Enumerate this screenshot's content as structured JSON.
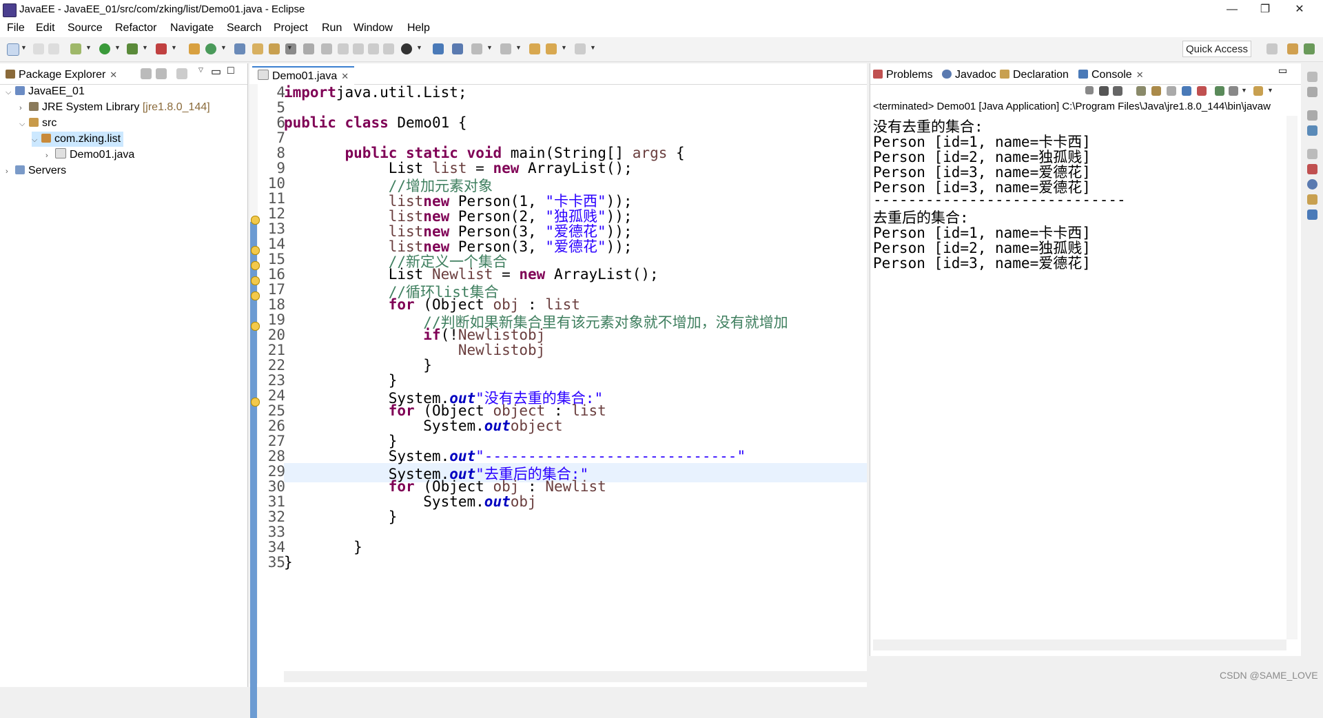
{
  "window": {
    "title": "JavaEE - JavaEE_01/src/com/zking/list/Demo01.java - Eclipse"
  },
  "menubar": [
    "File",
    "Edit",
    "Source",
    "Refactor",
    "Navigate",
    "Search",
    "Project",
    "Run",
    "Window",
    "Help"
  ],
  "toolbar": {
    "quick_access": "Quick Access"
  },
  "package_explorer": {
    "tab_label": "Package Explorer",
    "tree": [
      {
        "label": "JavaEE_01",
        "icon": "project-icon",
        "expanded": true
      },
      {
        "label": "JRE System Library",
        "suffix": "[jre1.8.0_144]",
        "icon": "library-icon"
      },
      {
        "label": "src",
        "icon": "source-folder-icon",
        "expanded": true
      },
      {
        "label": "com.zking.list",
        "icon": "package-icon",
        "expanded": true
      },
      {
        "label": "Demo01.java",
        "icon": "java-file-icon"
      },
      {
        "label": "Servers",
        "icon": "folder-icon"
      }
    ]
  },
  "editor": {
    "tab_label": "Demo01.java",
    "line_numbers": [
      "4",
      "5",
      "6",
      "7",
      "8",
      "9",
      "10",
      "11",
      "12",
      "13",
      "14",
      "15",
      "16",
      "17",
      "18",
      "19",
      "20",
      "21",
      "22",
      "23",
      "24",
      "25",
      "26",
      "27",
      "28",
      "29",
      "30",
      "31",
      "32",
      "33",
      "34",
      "35"
    ]
  },
  "right_panel": {
    "tabs": [
      "Problems",
      "Javadoc",
      "Declaration",
      "Console"
    ],
    "active_tab": "Console"
  },
  "console": {
    "status": "<terminated> Demo01 [Java Application] C:\\Program Files\\Java\\jre1.8.0_144\\bin\\javaw",
    "lines": [
      "没有去重的集合:",
      "Person [id=1, name=卡卡西]",
      "Person [id=2, name=独孤贱]",
      "Person [id=3, name=爱德花]",
      "Person [id=3, name=爱德花]",
      "-----------------------------",
      "去重后的集合:",
      "Person [id=1, name=卡卡西]",
      "Person [id=2, name=独孤贱]",
      "Person [id=3, name=爱德花]"
    ]
  },
  "watermark": "CSDN @SAME_LOVE",
  "colors": {
    "keyword": "#7f0055",
    "string": "#2a00ff",
    "comment": "#3f7f5f",
    "field": "#0000c0"
  }
}
